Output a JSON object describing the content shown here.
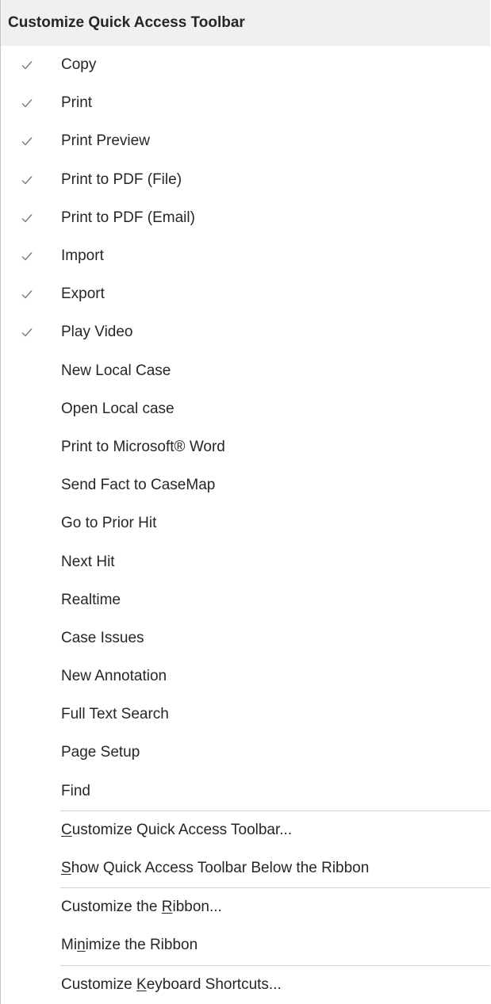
{
  "menu": {
    "header": "Customize Quick Access Toolbar",
    "items": [
      {
        "label": "Copy",
        "checked": true
      },
      {
        "label": "Print",
        "checked": true
      },
      {
        "label": "Print Preview",
        "checked": true
      },
      {
        "label": "Print to PDF (File)",
        "checked": true
      },
      {
        "label": "Print to PDF (Email)",
        "checked": true
      },
      {
        "label": "Import",
        "checked": true
      },
      {
        "label": "Export",
        "checked": true
      },
      {
        "label": "Play Video",
        "checked": true
      },
      {
        "label": "New Local Case",
        "checked": false
      },
      {
        "label": "Open Local case",
        "checked": false
      },
      {
        "label": "Print to Microsoft® Word",
        "checked": false
      },
      {
        "label": "Send Fact to CaseMap",
        "checked": false
      },
      {
        "label": "Go to Prior Hit",
        "checked": false
      },
      {
        "label": "Next Hit",
        "checked": false
      },
      {
        "label": "Realtime",
        "checked": false
      },
      {
        "label": "Case Issues",
        "checked": false
      },
      {
        "label": "New Annotation",
        "checked": false
      },
      {
        "label": "Full Text Search",
        "checked": false
      },
      {
        "label": "Page Setup",
        "checked": false
      },
      {
        "label": "Find",
        "checked": false
      }
    ],
    "commands": {
      "customize_qat": {
        "before": "",
        "accel": "C",
        "after": "ustomize Quick Access Toolbar..."
      },
      "show_below": {
        "before": "",
        "accel": "S",
        "after": "how Quick Access Toolbar Below the Ribbon"
      },
      "customize_ribbon": {
        "before": "Customize the ",
        "accel": "R",
        "after": "ibbon..."
      },
      "minimize_ribbon": {
        "before": "Mi",
        "accel": "n",
        "after": "imize the Ribbon"
      },
      "customize_keyboard": {
        "before": "Customize ",
        "accel": "K",
        "after": "eyboard Shortcuts..."
      }
    }
  },
  "colors": {
    "text": "#262626",
    "header_bg": "#f0f0f0",
    "check": "#7a7a7a",
    "separator": "#d4d4d4"
  },
  "icons": {
    "checked": "check-mark-icon"
  }
}
